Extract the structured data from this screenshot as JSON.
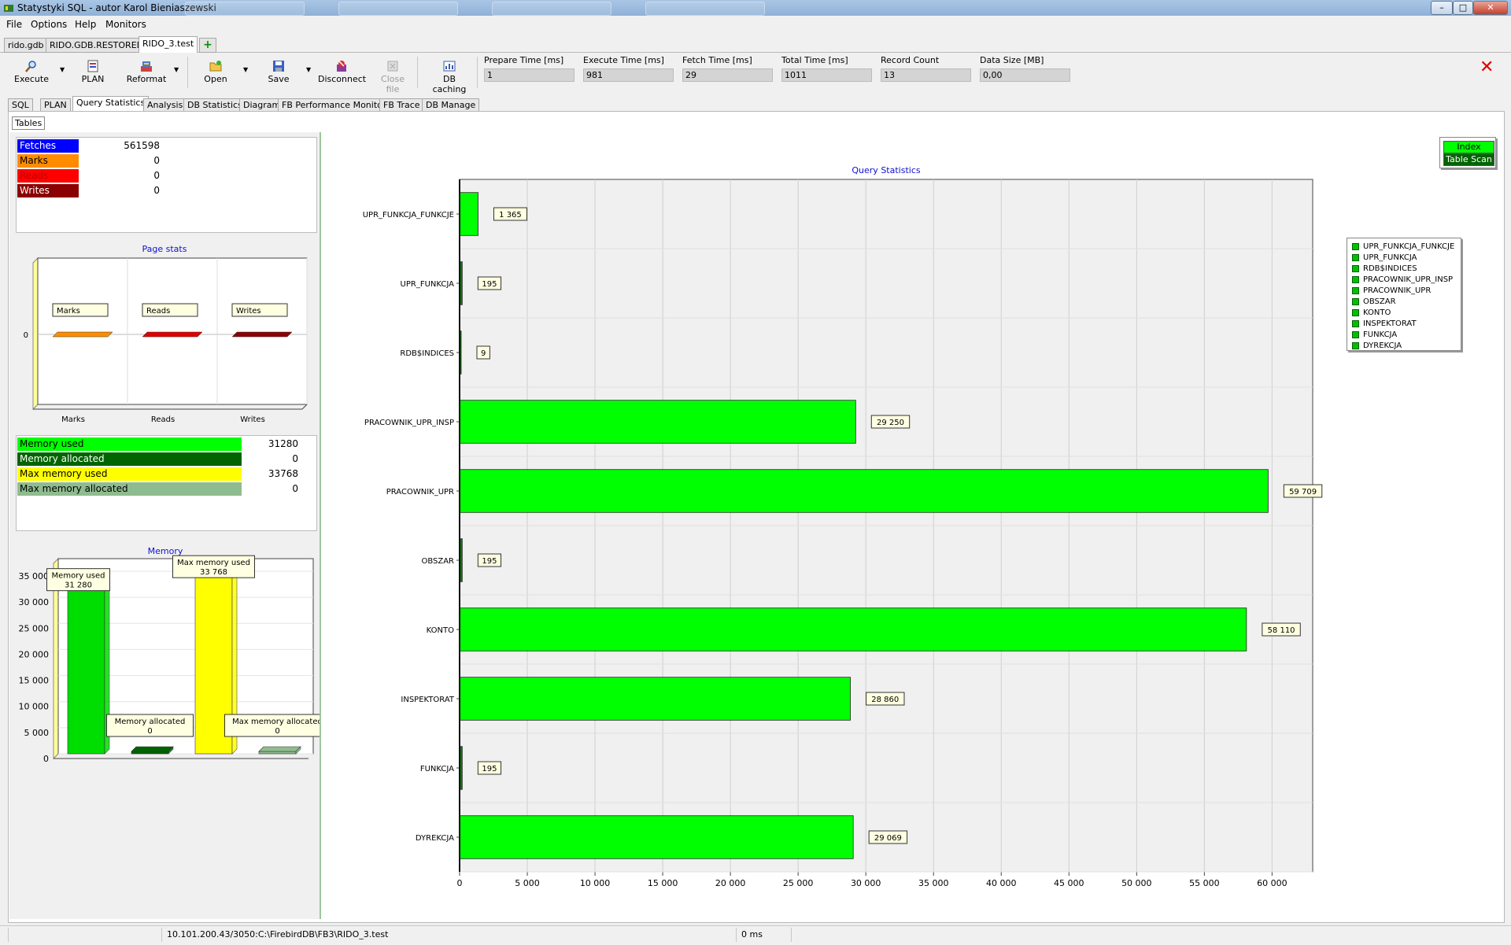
{
  "window": {
    "title": "Statystyki SQL - autor Karol Bieniaszewski",
    "buttons": {
      "minimize": "–",
      "maximize": "□",
      "close": "✕"
    }
  },
  "menu": [
    "File",
    "Options",
    "Help",
    "Monitors"
  ],
  "doc_tabs": [
    "rido.gdb",
    "RIDO.GDB.RESTORED",
    "RIDO_3.test"
  ],
  "add_tab": "+",
  "toolbar": {
    "execute": "Execute",
    "plan": "PLAN",
    "reformat": "Reformat",
    "open": "Open",
    "save": "Save",
    "disconnect": "Disconnect",
    "close_file": "Close file",
    "db_caching": "DB caching"
  },
  "metrics": [
    {
      "label": "Prepare Time [ms]",
      "value": "1"
    },
    {
      "label": "Execute Time [ms]",
      "value": "981"
    },
    {
      "label": "Fetch Time [ms]",
      "value": "29"
    },
    {
      "label": "Total Time [ms]",
      "value": "1011"
    },
    {
      "label": "Record Count",
      "value": "13"
    },
    {
      "label": "Data Size [MB]",
      "value": "0,00"
    }
  ],
  "view_tabs": [
    "SQL",
    "PLAN",
    "Query Statistics",
    "Analysis",
    "DB Statistics",
    "Diagram",
    "FB Performance Monitor",
    "FB Trace",
    "DB Manage"
  ],
  "sub_tab": "Tables",
  "io_stats": [
    {
      "label": "Fetches",
      "value": "561598",
      "color": "#0000ff",
      "text_color": "#ffffff"
    },
    {
      "label": "Marks",
      "value": "0",
      "color": "#ff8c00",
      "text_color": "#000000"
    },
    {
      "label": "Reads",
      "value": "0",
      "color": "#ff0000",
      "text_color": "#c00000"
    },
    {
      "label": "Writes",
      "value": "0",
      "color": "#8b0000",
      "text_color": "#ffffff"
    }
  ],
  "memory_stats": [
    {
      "label": "Memory used",
      "value": "31280",
      "color": "#00ff00",
      "text_color": "#000000"
    },
    {
      "label": "Memory allocated",
      "value": "0",
      "color": "#006400",
      "text_color": "#ffffff"
    },
    {
      "label": "Max memory used",
      "value": "33768",
      "color": "#ffff00",
      "text_color": "#000000"
    },
    {
      "label": "Max memory allocated",
      "value": "0",
      "color": "#8fbc8f",
      "text_color": "#000000"
    }
  ],
  "page_stats_chart": {
    "title": "Page stats",
    "categories": [
      "Marks",
      "Reads",
      "Writes"
    ],
    "values": [
      0,
      0,
      0
    ],
    "y_tick": "0",
    "colors": [
      "#ff8c00",
      "#e00000",
      "#8b0000"
    ]
  },
  "memory_chart": {
    "title": "Memory",
    "ymax": 35000,
    "y_ticks": [
      "0",
      "5 000",
      "10 000",
      "15 000",
      "20 000",
      "25 000",
      "30 000",
      "35 000"
    ],
    "bars": [
      {
        "label": "Memory used",
        "value": 31280,
        "display": "31 280",
        "color": "#00dd00"
      },
      {
        "label": "Memory allocated",
        "value": 0,
        "display": "0",
        "color": "#006400"
      },
      {
        "label": "Max memory used",
        "value": 33768,
        "display": "33 768",
        "color": "#ffff00"
      },
      {
        "label": "Max memory allocated",
        "value": 0,
        "display": "0",
        "color": "#8fbc8f"
      }
    ]
  },
  "chart_data": {
    "type": "bar",
    "title": "Query Statistics",
    "orientation": "horizontal",
    "categories": [
      "UPR_FUNKCJA_FUNKCJE",
      "UPR_FUNKCJA",
      "RDB$INDICES",
      "PRACOWNIK_UPR_INSP",
      "PRACOWNIK_UPR",
      "OBSZAR",
      "KONTO",
      "INSPEKTORAT",
      "FUNKCJA",
      "DYREKCJA"
    ],
    "series": [
      {
        "name": "Index",
        "values": [
          1365,
          195,
          9,
          29250,
          59709,
          195,
          58110,
          28860,
          195,
          29069
        ],
        "color": "#00ff00"
      }
    ],
    "value_labels": [
      "1 365",
      "195",
      "9",
      "29 250",
      "59 709",
      "195",
      "58 110",
      "28 860",
      "195",
      "29 069"
    ],
    "x_ticks": [
      "0",
      "5 000",
      "10 000",
      "15 000",
      "20 000",
      "25 000",
      "30 000",
      "35 000",
      "40 000",
      "45 000",
      "50 000",
      "55 000",
      "60 000"
    ],
    "xlim": [
      0,
      63000
    ],
    "grid": true,
    "legend_position": "right"
  },
  "legend_type": [
    {
      "label": "Index",
      "color": "#00ff00",
      "text_color": "#000000"
    },
    {
      "label": "Table Scan",
      "color": "#006400",
      "text_color": "#ffffff"
    }
  ],
  "statusbar": {
    "path": "10.101.200.43/3050:C:\\FirebirdDB\\FB3\\RIDO_3.test",
    "time": "0 ms"
  }
}
